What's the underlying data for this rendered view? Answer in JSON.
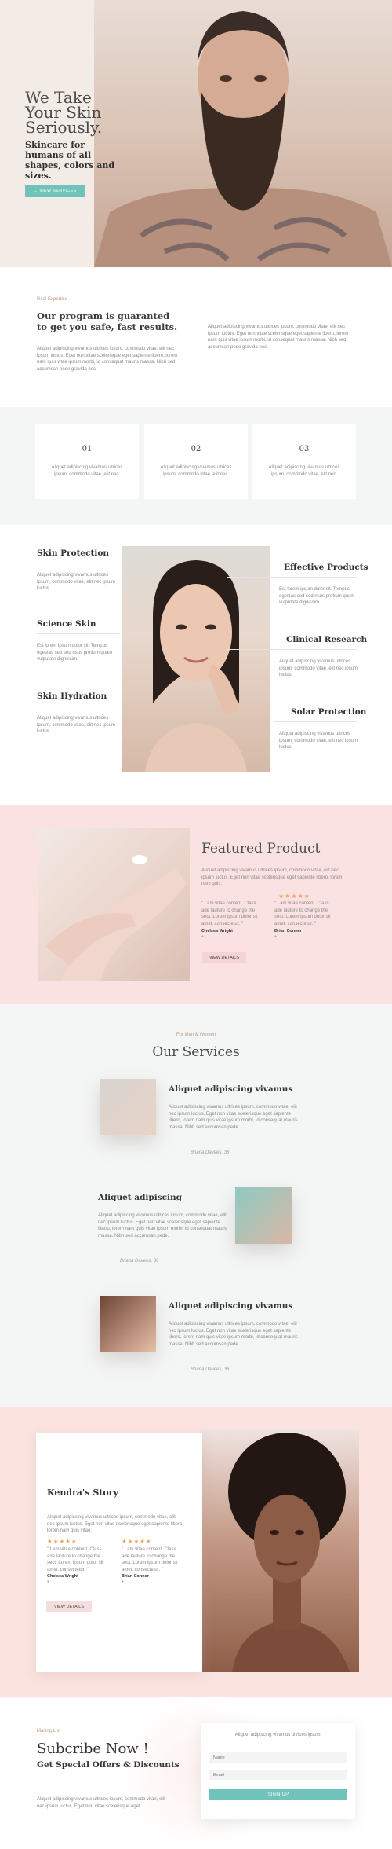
{
  "hero": {
    "title": "We Take Your Skin Seriously.",
    "subtitle": "Skincare for humans of all shapes, colors and sizes.",
    "button_label": "→  VIEW SERVICES"
  },
  "intro": {
    "eyebrow": "Real Expertise",
    "title": "Our program is guaranted to get you safe, fast results.",
    "text_left": "Aliquet adipiscing vivamus ultrices ipsum, commodo vitae, elit nec ipsum luctus. Eget non vitae scelerisque eget sapiente libero, lorem nam quis vitae ipsum morbi, id consequat mauris massa. Nibh sed accumsan pede gravida nec.",
    "text_right": "Aliquet adipiscing vivamus ultrices ipsum, commodo vitae, elit nec ipsum luctus. Eget non vitae scelerisque eget sapiente libero, lorem nam quis vitae ipsum morbi, id consequat mauris massa. Nibh sed accumsan pede gravida nec."
  },
  "steps": [
    {
      "number": "01",
      "text": "Aliquet adipiscing vivamus ultrices ipsum, commodo vitae, elit nec."
    },
    {
      "number": "02",
      "text": "Aliquet adipiscing vivamus ultrices ipsum, commodo vitae, elit nec."
    },
    {
      "number": "03",
      "text": "Aliquet adipiscing vivamus ultrices ipsum, commodo vitae, elit nec."
    }
  ],
  "features": {
    "skin_protection": {
      "title": "Skin Protection",
      "text": "Aliquet adipiscing vivamus ultrices ipsum, commodo vitae, elit nec ipsum luctus."
    },
    "science_skin": {
      "title": "Science Skin",
      "text": "Est lorem ipsum dolor sit. Tempus egestas sed sed risus pretium quam vulputate dignissim."
    },
    "skin_hydration": {
      "title": "Skin Hydration",
      "text": "Aliquet adipiscing vivamus ultrices ipsum, commodo vitae, elit nec ipsum luctus."
    },
    "effective_products": {
      "title": "Effective Products",
      "text": "Est lorem ipsum dolor sit. Tempus egestas sed sed risus pretium quam vulputate dignissim."
    },
    "clinical_research": {
      "title": "Clinical Research",
      "text": "Aliquet adipiscing vivamus ultrices ipsum, commodo vitae, elit nec ipsum luctus."
    },
    "solar_protection": {
      "title": "Solar Protection",
      "text": "Aliquet adipiscing vivamus ultrices ipsum, commodo vitae, elit nec ipsum luctus."
    }
  },
  "product": {
    "title": "Featured Product",
    "text": "Aliquet adipiscing vivamus ultrices ipsum, commodo vitae, elit nec ipsum luctus. Eget non vitae scelerisque eget sapiente libero, lorem nam quis.",
    "stars": "★★★★★",
    "quote1": "\" I am vitae content. Class ade lauture to change the sect. Lorem ipsum dolor sit amet. consectetur. \"",
    "name1": "Chelsea Wright",
    "role1": "●",
    "quote2": "\" I am vitae content. Class ade lauture to change the sect. Lorem ipsum dolor sit amet. consectetur. \"",
    "name2": "Brian Conner",
    "role2": "●",
    "button_label": "VIEW DETAILS"
  },
  "services": {
    "eyebrow": "For Men & Women",
    "title": "Our Services",
    "items": [
      {
        "title": "Aliquet adipiscing vivamus",
        "text": "Aliquet adipiscing vivamus ultrices ipsum, commodo vitae, elit nec ipsum luctus. Eget non vitae scelerisque eget sapiente libero, lorem nam quis vitae ipsum morbi, id consequat mauris massa. Nibh sed accumsan pede.",
        "signature": "Briana Davees, 36"
      },
      {
        "title": "Aliquet adipiscing",
        "text": "Aliquet adipiscing vivamus ultrices ipsum, commodo vitae, elit nec ipsum luctus. Eget non vitae scelerisque eget sapiente libero, lorem nam quis vitae ipsum morbi, id consequat mauris massa. Nibh sed accumsan pede.",
        "signature": "Briana Davees, 36"
      },
      {
        "title": "Aliquet adipiscing vivamus",
        "text": "Aliquet adipiscing vivamus ultrices ipsum, commodo vitae, elit nec ipsum luctus. Eget non vitae scelerisque eget sapiente libero, lorem nam quis vitae ipsum morbi, id consequat mauris massa. Nibh sed accumsan pede.",
        "signature": "Briana Davees, 36"
      }
    ]
  },
  "story": {
    "title": "Kendra's Story",
    "text": "Aliquet adipiscing vivamus ultrices ipsum, commodo vitae, elit nec ipsum luctus. Eget non vitae scelerisque eget sapiente libero, lorem nam quis vitae.",
    "stars": "★★★★★",
    "quote1": "\" I am vitae content. Class ade lauture to change the sect. Lorem ipsum dolor sit amet. consectetur. \"",
    "name1": "Chelsea Wright",
    "role1": "●",
    "quote2": "\" I am vitae content. Class ade lauture to change the sect. Lorem ipsum dolor sit amet. consectetur. \"",
    "name2": "Brian Conner",
    "role2": "●",
    "button_label": "VIEW DETAILS"
  },
  "subscribe": {
    "eyebrow": "Mailing List",
    "title": "Subcribe Now !",
    "subtitle": "Get Special Offers & Discounts",
    "text": "Aliquet adipiscing vivamus ultrices ipsum, commodo vitae, elit nec ipsum luctus. Eget non vitae scelerisque eget.",
    "form_heading": "Aliquet adipiscing vivamus ultrices ipsum.",
    "name_placeholder": "Name",
    "email_placeholder": "Email",
    "button_label": "SIGN UP"
  },
  "colors": {
    "accent": "#6fc3bb",
    "blush": "#fbe2e2",
    "star": "#f2a65a"
  }
}
